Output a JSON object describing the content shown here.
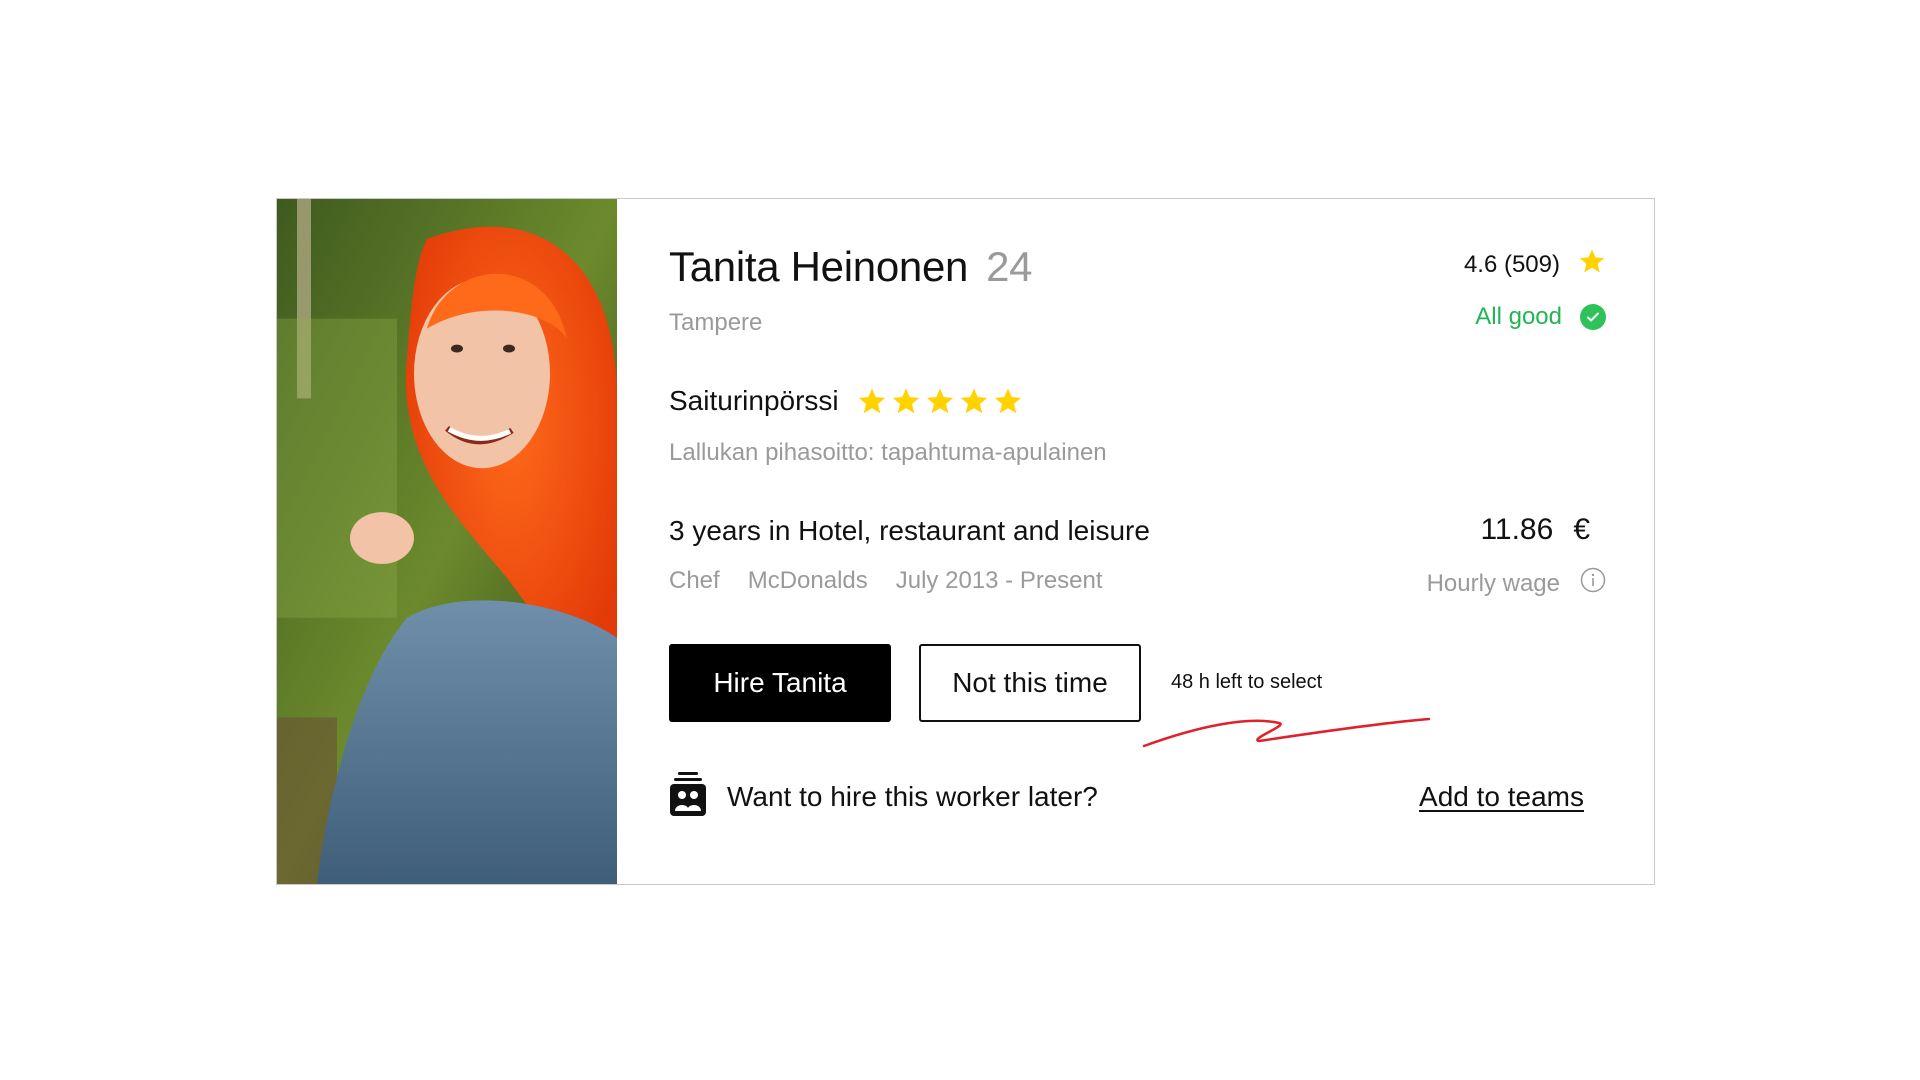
{
  "profile": {
    "name": "Tanita Heinonen",
    "age": "24",
    "city": "Tampere",
    "rating_text": "4.6 (509)",
    "status": "All good"
  },
  "review": {
    "company": "Saiturinpörssi",
    "stars": 5,
    "role": "Lallukan pihasoitto: tapahtuma-apulainen"
  },
  "experience": {
    "summary": "3 years in Hotel, restaurant and leisure",
    "title": "Chef",
    "employer": "McDonalds",
    "period": "July 2013 - Present"
  },
  "wage": {
    "amount": "11.86",
    "currency": "€",
    "label": "Hourly wage"
  },
  "actions": {
    "hire_label": "Hire Tanita",
    "decline_label": "Not this time",
    "time_left": "48 h left to select"
  },
  "teams": {
    "prompt": "Want to hire this worker later?",
    "link_label": "Add to teams"
  },
  "colors": {
    "star": "#ffd200",
    "status_green": "#22b552",
    "scribble": "#e0202a"
  },
  "icons": {
    "rating": "star-icon",
    "status": "check-circle-icon",
    "wage_info": "info-icon",
    "teams": "team-icon"
  }
}
